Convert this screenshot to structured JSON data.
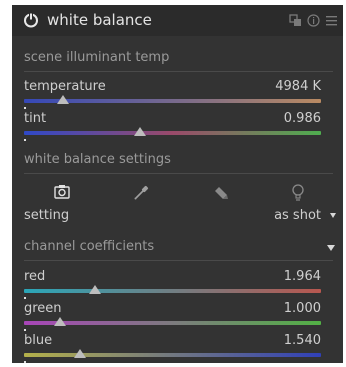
{
  "header": {
    "title": "white balance",
    "icons": [
      "power-icon",
      "presets-icon",
      "reset-icon",
      "menu-icon"
    ]
  },
  "sections": {
    "illuminant": {
      "title": "scene illuminant temp"
    },
    "wb_settings": {
      "title": "white balance settings"
    },
    "channels": {
      "title": "channel coefficients"
    }
  },
  "sliders": {
    "temperature": {
      "label": "temperature",
      "value": "4984 K",
      "position": 0.13
    },
    "tint": {
      "label": "tint",
      "value": "0.986",
      "position": 0.39
    },
    "red": {
      "label": "red",
      "value": "1.964",
      "position": 0.24
    },
    "green": {
      "label": "green",
      "value": "1.000",
      "position": 0.12
    },
    "blue": {
      "label": "blue",
      "value": "1.540",
      "position": 0.19
    }
  },
  "setting": {
    "label": "setting",
    "value": "as shot",
    "tools": [
      "camera-icon",
      "color-picker-icon",
      "user-modified-icon",
      "bulb-icon"
    ]
  },
  "colors": {
    "panel_bg": "#333333",
    "header_bg": "#2b2b2b",
    "temperature_from": "#3548b8",
    "temperature_to": "#b98a62",
    "tint_from": "#2f49c8",
    "tint_mid": "#9a4a6a",
    "tint_to": "#4fae4f",
    "red_from": "#2aa6b8",
    "red_to": "#b8574f",
    "green_from": "#a845b8",
    "green_to": "#52b145",
    "blue_from": "#b4b04a",
    "blue_to": "#3040b8"
  }
}
